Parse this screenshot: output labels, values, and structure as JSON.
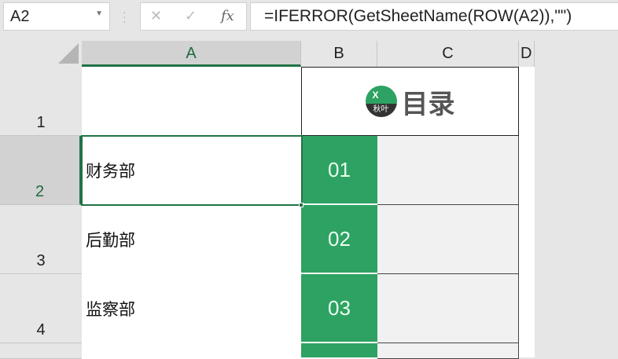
{
  "name_box": {
    "value": "A2"
  },
  "formula_bar": {
    "cancel_icon": "✕",
    "enter_icon": "✓",
    "fx_label": "fx",
    "formula": "=IFERROR(GetSheetName(ROW(A2)),\"\")"
  },
  "columns": [
    "A",
    "B",
    "C",
    "D"
  ],
  "rows": [
    "1",
    "2",
    "3",
    "4"
  ],
  "title_cell": {
    "text": "目录",
    "logo_top": "X",
    "logo_bottom": "秋叶"
  },
  "departments": [
    {
      "name": "财务部",
      "num": "01"
    },
    {
      "name": "后勤部",
      "num": "02"
    },
    {
      "name": "监察部",
      "num": "03"
    }
  ],
  "colors": {
    "green": "#2ea262",
    "selection": "#217346"
  }
}
